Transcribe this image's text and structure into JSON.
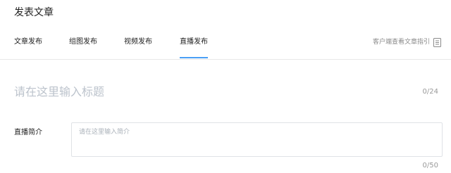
{
  "page": {
    "title": "发表文章"
  },
  "tabs": [
    {
      "label": "文章发布"
    },
    {
      "label": "组图发布"
    },
    {
      "label": "视频发布"
    },
    {
      "label": "直播发布"
    }
  ],
  "guide_link": {
    "label": "客户端查看文章指引",
    "icon": "document-icon"
  },
  "title_field": {
    "placeholder": "请在这里输入标题",
    "counter": "0/24"
  },
  "intro_field": {
    "label": "直播简介",
    "placeholder": "请在这里输入简介",
    "counter": "0/50"
  },
  "colors": {
    "active_tab_underline": "#4a9ff5",
    "divider": "#e8e8e8",
    "placeholder": "#bcc3cc"
  }
}
